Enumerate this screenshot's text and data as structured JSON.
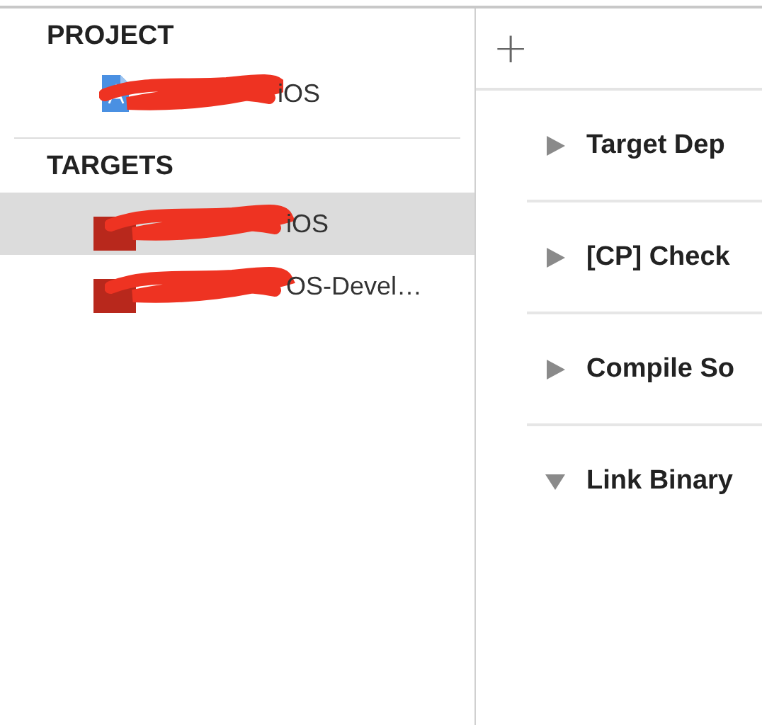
{
  "project": {
    "heading": "PROJECT",
    "items": [
      {
        "name": "iOS",
        "selected": false
      }
    ]
  },
  "targets": {
    "heading": "TARGETS",
    "items": [
      {
        "name": "iOS",
        "selected": true
      },
      {
        "name": "OS-Devel…",
        "selected": false
      }
    ]
  },
  "toolbar": {
    "add": "+"
  },
  "build_phases": [
    {
      "title": "Target Dep",
      "expanded": false
    },
    {
      "title": "[CP] Check",
      "expanded": false
    },
    {
      "title": "Compile So",
      "expanded": false
    },
    {
      "title": "Link Binary",
      "expanded": true
    }
  ]
}
